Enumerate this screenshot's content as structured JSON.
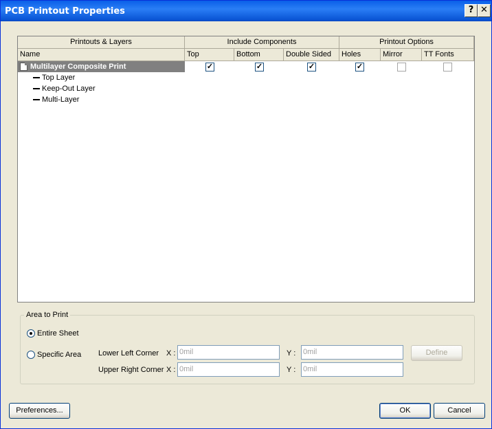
{
  "window": {
    "title": "PCB Printout Properties",
    "help_label": "?",
    "close_label": "✕"
  },
  "grid": {
    "group_headers": [
      "Printouts & Layers",
      "Include Components",
      "Printout Options"
    ],
    "columns": [
      "Name",
      "Top",
      "Bottom",
      "Double Sided",
      "Holes",
      "Mirror",
      "TT Fonts"
    ],
    "rows": [
      {
        "name": "Multilayer Composite Print",
        "checks": [
          true,
          true,
          true,
          true,
          false,
          false
        ],
        "selected": true
      },
      {
        "name": "Top Layer"
      },
      {
        "name": "Keep-Out Layer"
      },
      {
        "name": "Multi-Layer"
      }
    ]
  },
  "area": {
    "label": "Area to Print",
    "entire_sheet": "Entire Sheet",
    "specific_area": "Specific Area",
    "selected": "entire_sheet",
    "lower_left": "Lower Left Corner",
    "upper_right": "Upper Right Corner",
    "x_label": "X :",
    "y_label": "Y :",
    "ll_x": "0mil",
    "ll_y": "0mil",
    "ur_x": "0mil",
    "ur_y": "0mil",
    "define": "Define"
  },
  "buttons": {
    "preferences": "Preferences...",
    "ok": "OK",
    "cancel": "Cancel"
  }
}
